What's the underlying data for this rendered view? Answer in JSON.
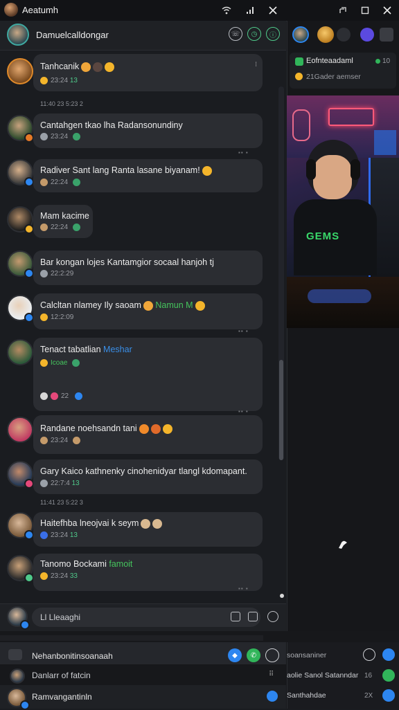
{
  "titlebar": {
    "title": "Aeatumh",
    "icons": [
      "wifi-icon",
      "signal-icon",
      "close-icon",
      "restore-icon",
      "maximize-icon",
      "close-window-icon"
    ]
  },
  "chat_header": {
    "title": "Damuelcalldongar"
  },
  "messages": [
    {
      "text": "Tanhcanik",
      "meta": "23:24",
      "badge": "13"
    },
    {
      "text": "Cantahgen tkao lha Radansonundiny",
      "meta": "23:24",
      "badge": ""
    },
    {
      "text": "Radiver Sant lang Ranta lasane biyanam!",
      "meta": "22:24",
      "badge": ""
    },
    {
      "text": "Mam kacime",
      "meta": "22:24",
      "badge": ""
    },
    {
      "text": "Bar kongan lojes Kantamgior socaal hanjoh tj",
      "meta": "22:2:29",
      "badge": ""
    },
    {
      "text": "Calcltan nlamey Ily saoam",
      "highlight": "Namun M",
      "meta": "12:2:09",
      "badge": ""
    },
    {
      "text": "Tenact tabatlian",
      "highlight": "Meshar",
      "sub": "Icoae",
      "meta": "22",
      "badge": ""
    },
    {
      "text": "Randane noehsandn tani",
      "meta": "23:24",
      "badge": ""
    },
    {
      "text": "Gary Kaico kathnenky cinohenidyar tlangl kdomapant.",
      "meta": "22:7:4",
      "badge": "13"
    },
    {
      "text": "Haitefhba lneojvai k seym",
      "meta": "23:24",
      "badge": "13"
    },
    {
      "text": "Tanomo Bockami",
      "highlight": "famoit",
      "meta": "23:24",
      "badge": "33"
    }
  ],
  "separators": [
    "11:40 23 5:23 2",
    "11:41 23 5:22 3"
  ],
  "composer": {
    "placeholder": "Ll Lleaaghi"
  },
  "bottom_panel": {
    "rows": [
      {
        "label": "Nehanbonitinsoanaah"
      },
      {
        "label": "Danlarr of fatcin"
      },
      {
        "label": "Ramvangantinln"
      }
    ],
    "right_rows": [
      {
        "label": "soansaniner"
      },
      {
        "label": "aolie Sanol Satanndar",
        "value": "16"
      },
      {
        "label": "Santhahdae",
        "value": "2X"
      }
    ]
  },
  "right_panel": {
    "status_title": "Eofnteaadaml",
    "status_sub": "21Gader aemser",
    "status_count": "10",
    "video_label": "GEMS"
  },
  "colors": {
    "accent_green": "#4fc98a",
    "accent_blue": "#2d86f0",
    "emoji_yellow": "#f4b52b",
    "highlight_green": "#45c45d",
    "highlight_blue": "#3a8fe8"
  }
}
